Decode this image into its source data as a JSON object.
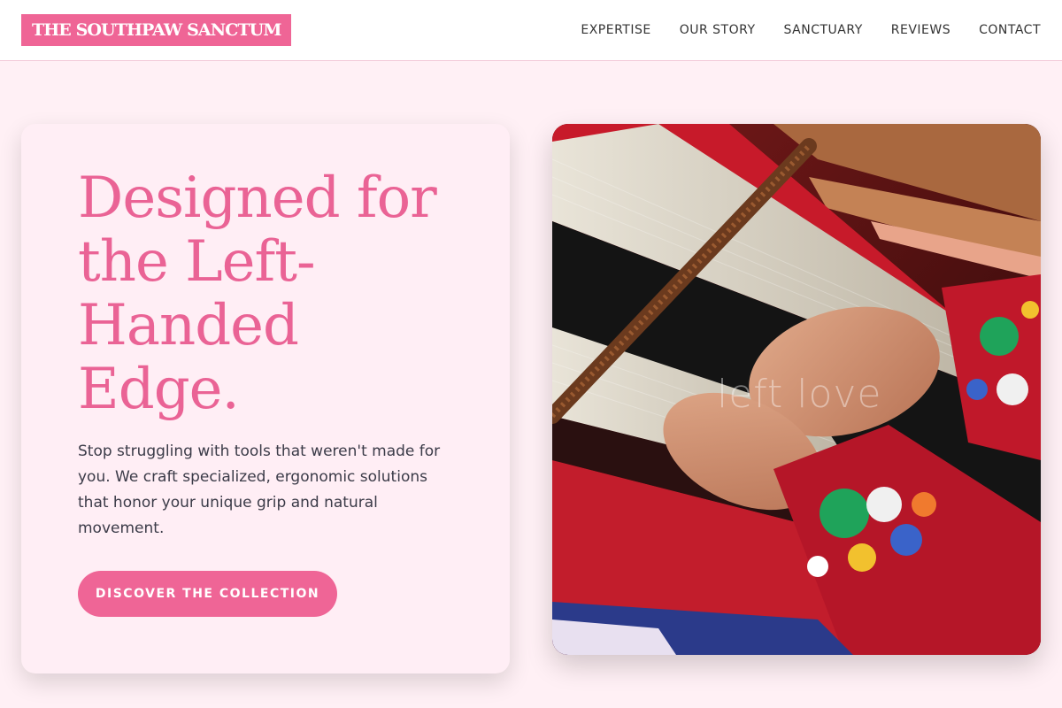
{
  "brand": {
    "name": "THE SOUTHPAW SANCTUM"
  },
  "nav": {
    "items": [
      {
        "label": "EXPERTISE"
      },
      {
        "label": "OUR STORY"
      },
      {
        "label": "SANCTUARY"
      },
      {
        "label": "REVIEWS"
      },
      {
        "label": "CONTACT"
      }
    ]
  },
  "hero": {
    "title": "Designed for the Left-Handed Edge.",
    "description": "Stop struggling with tools that weren't made for you. We craft specialized, ergonomic solutions that honor your unique grip and natural movement.",
    "cta_label": "DISCOVER THE COLLECTION",
    "image_overlay_text": "left love"
  },
  "colors": {
    "accent": "#ef6596",
    "background": "#fff0f5",
    "card": "#ffeef5",
    "text": "#3b3b48"
  }
}
